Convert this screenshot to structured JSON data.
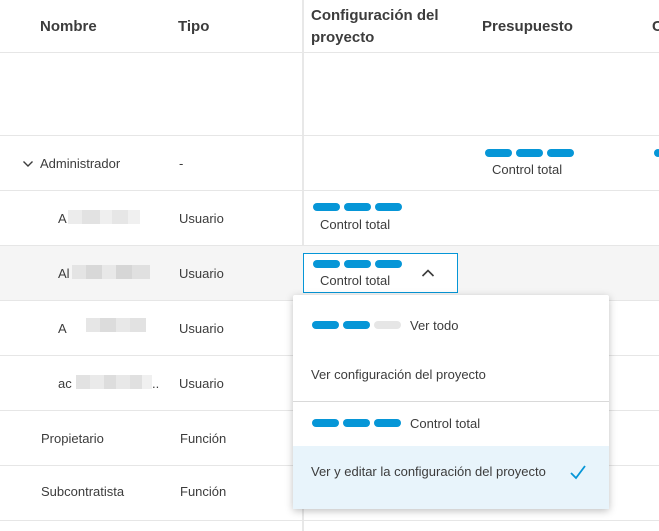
{
  "columns": {
    "name": "Nombre",
    "type": "Tipo",
    "config_line1": "Configuración del",
    "config_line2": "proyecto",
    "budget": "Presupuesto",
    "next_partial": "C"
  },
  "rows": [
    {
      "name": "Administrador",
      "type": "-",
      "budget": "Control total",
      "expanded": true
    },
    {
      "name": "A",
      "type": "Usuario",
      "config": "Control total"
    },
    {
      "name": "Al",
      "type": "Usuario",
      "config": "Control total",
      "highlighted": true
    },
    {
      "name": "A",
      "type": "Usuario"
    },
    {
      "name": "ac",
      "type": "Usuario",
      "ellipsis": ".."
    },
    {
      "name": "Propietario",
      "type": "Función"
    },
    {
      "name": "Subcontratista",
      "type": "Función"
    }
  ],
  "dropdown": {
    "options": [
      {
        "label": "Ver todo",
        "level": 2
      },
      {
        "label": "Ver configuración del proyecto"
      },
      {
        "label": "Control total",
        "level": 3
      },
      {
        "label": "Ver y editar la configuración del proyecto",
        "selected": true
      }
    ]
  },
  "colors": {
    "accent": "#0696d7",
    "pill_off": "#e6e6e6",
    "row_highlight": "#f5f5f5",
    "selected_bg": "#e8f4fb"
  }
}
